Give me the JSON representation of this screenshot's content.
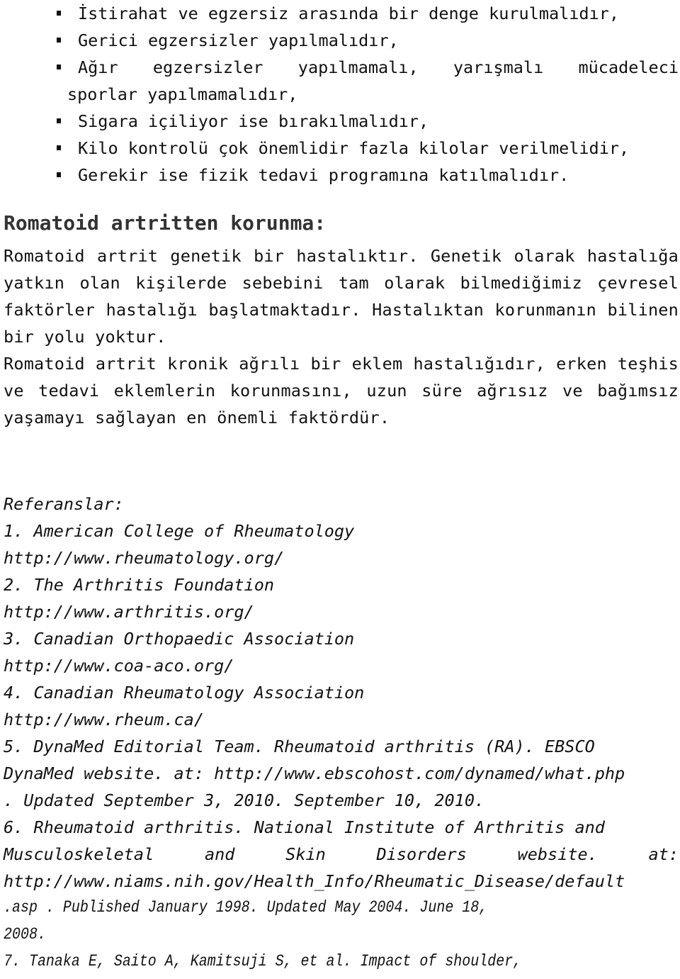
{
  "bullets": [
    {
      "text": "İstirahat ve egzersiz arasında bir denge kurulmalıdır,"
    },
    {
      "text": "Gerici egzersizler yapılmalıdır,"
    },
    {
      "first_line": "Ağır egzersizler yapılmamalı, yarışmalı mücadeleci",
      "continuation": "sporlar yapılmamalıdır,"
    },
    {
      "text": "Sigara içiliyor ise bırakılmalıdır,"
    },
    {
      "text": "Kilo kontrolü çok önemlidir fazla kilolar verilmelidir,"
    },
    {
      "text": "Gerekir ise fizik tedavi programına katılmalıdır."
    }
  ],
  "section": {
    "heading": "Romatoid artritten korunma:",
    "paragraph_1": "Romatoid artrit genetik bir hastalıktır. Genetik olarak hastalığa yatkın olan kişilerde sebebini tam olarak bilmediğimiz çevresel faktörler hastalığı başlatmaktadır. Hastalıktan korunmanın bilinen bir yolu yoktur.",
    "paragraph_2": "Romatoid artrit kronik ağrılı bir eklem hastalığıdır, erken teşhis ve tedavi eklemlerin korunmasını, uzun süre ağrısız ve bağımsız yaşamayı sağlayan en önemli faktördür."
  },
  "references": {
    "title": "Referanslar:",
    "items": [
      {
        "name": "1. American College of Rheumatology",
        "link": "http://www.rheumatology.org/"
      },
      {
        "name": "2. The Arthritis Foundation",
        "link": "http://www.arthritis.org/"
      },
      {
        "name": "3. Canadian Orthopaedic Association",
        "link": "http://www.coa-aco.org/"
      },
      {
        "name": "4. Canadian Rheumatology Association",
        "link": "http://www.rheum.ca/"
      }
    ],
    "ref5": {
      "line1": "5. DynaMed Editorial Team. Rheumatoid arthritis (RA). EBSCO",
      "line2": "DynaMed website. at: http://www.ebscohost.com/dynamed/what.php",
      "line3": ". Updated September 3, 2010. September 10, 2010."
    },
    "ref6": {
      "line1": "6. Rheumatoid arthritis. National Institute of Arthritis and",
      "line2": "Musculoskeletal and Skin Disorders website. at:",
      "line3": "http://www.niams.nih.gov/Health_Info/Rheumatic_Disease/default",
      "line4": ".asp . Published January 1998. Updated May 2004. June 18,",
      "line5": "2008."
    },
    "ref7": {
      "line1": "7. Tanaka E, Saito A, Kamitsuji S, et al. Impact of shoulder,"
    }
  }
}
